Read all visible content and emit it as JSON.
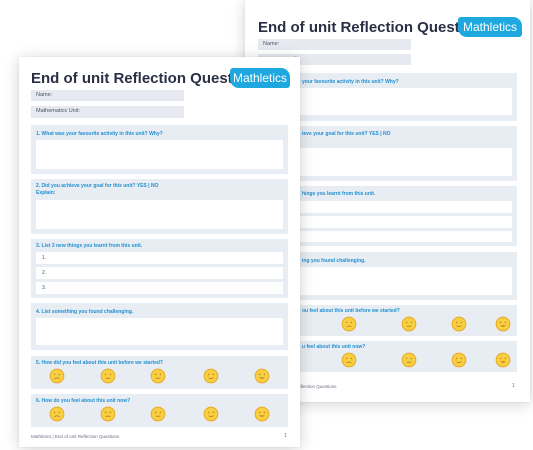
{
  "colors": {
    "accent": "#1fa8e0",
    "label_blue": "#1f8fd1",
    "face_yellow": "#f4c73a",
    "section_bg": "#e8edf3"
  },
  "back": {
    "title": "End of unit Reflection Questions",
    "logo": "Mathletics",
    "name_label": "Name:",
    "unit_label_partial": "it:",
    "q1_partial": "your favourite activity in this unit? Why?",
    "q2_partial": "ieve your goal for this unit?   YES  |  NO",
    "q3_partial": "hings you learnt from this unit.",
    "q4_partial": "ing you found challenging.",
    "q5_partial": "ou feel about this unit before we started?",
    "q6_partial": "u feel about this unit now?",
    "footer_partial": "nit Reflection Questions",
    "page_number": "1"
  },
  "front": {
    "title": "End of unit Reflection Questions",
    "logo": "Mathletics",
    "name_label": "Name:",
    "unit_label": "Mathematics Unit:",
    "q1": "1. What was your favourite activity in this unit? Why?",
    "q2": "2. Did you achieve your goal for this unit?   YES  |  NO",
    "q2_explain": "Explain:",
    "q3": "3. List 3 new things you learnt from this unit.",
    "q3_items": [
      "1.",
      "2.",
      "3."
    ],
    "q4": "4. List something you found challenging.",
    "q5": "5. How did you feel about this unit before we started?",
    "q6": "6. How do you feel about this unit now?",
    "footer": "Mathletics | End of unit Reflection Questions",
    "page_number": "1"
  },
  "emoji_scale": [
    "very-sad-face-icon",
    "sad-face-icon",
    "neutral-face-icon",
    "smiling-face-icon",
    "grinning-face-icon"
  ]
}
